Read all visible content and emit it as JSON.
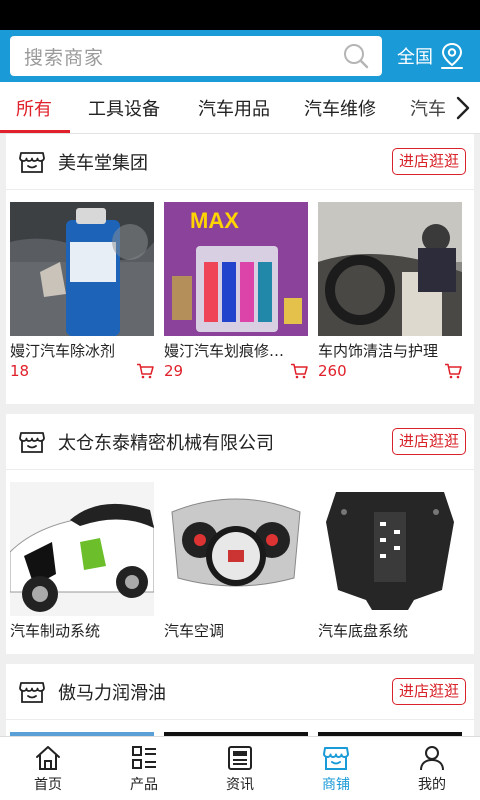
{
  "header": {
    "search_placeholder": "搜索商家",
    "region_label": "全国"
  },
  "tabs": [
    {
      "label": "所有",
      "active": true
    },
    {
      "label": "工具设备",
      "active": false
    },
    {
      "label": "汽车用品",
      "active": false
    },
    {
      "label": "汽车维修",
      "active": false
    },
    {
      "label": "汽车",
      "active": false
    }
  ],
  "stores": [
    {
      "name": "美车堂集团",
      "visit_label": "进店逛逛",
      "products": [
        {
          "name": "嫚汀汽车除冰剂",
          "price": "18"
        },
        {
          "name": "嫚汀汽车划痕修…",
          "price": "29"
        },
        {
          "name": "车内饰清洁与护理",
          "price": "260"
        }
      ]
    },
    {
      "name": "太仓东泰精密机械有限公司",
      "visit_label": "进店逛逛",
      "products": [
        {
          "name": "汽车制动系统"
        },
        {
          "name": "汽车空调"
        },
        {
          "name": "汽车底盘系统"
        }
      ]
    },
    {
      "name": "傲马力润滑油",
      "visit_label": "进店逛逛",
      "products": []
    }
  ],
  "bottom_nav": [
    {
      "label": "首页",
      "icon": "home-icon",
      "active": false
    },
    {
      "label": "产品",
      "icon": "product-list-icon",
      "active": false
    },
    {
      "label": "资讯",
      "icon": "news-icon",
      "active": false
    },
    {
      "label": "商铺",
      "icon": "shop-icon",
      "active": true
    },
    {
      "label": "我的",
      "icon": "user-icon",
      "active": false
    }
  ],
  "colors": {
    "brand_blue": "#1a9ad6",
    "accent_red": "#e0202a"
  }
}
